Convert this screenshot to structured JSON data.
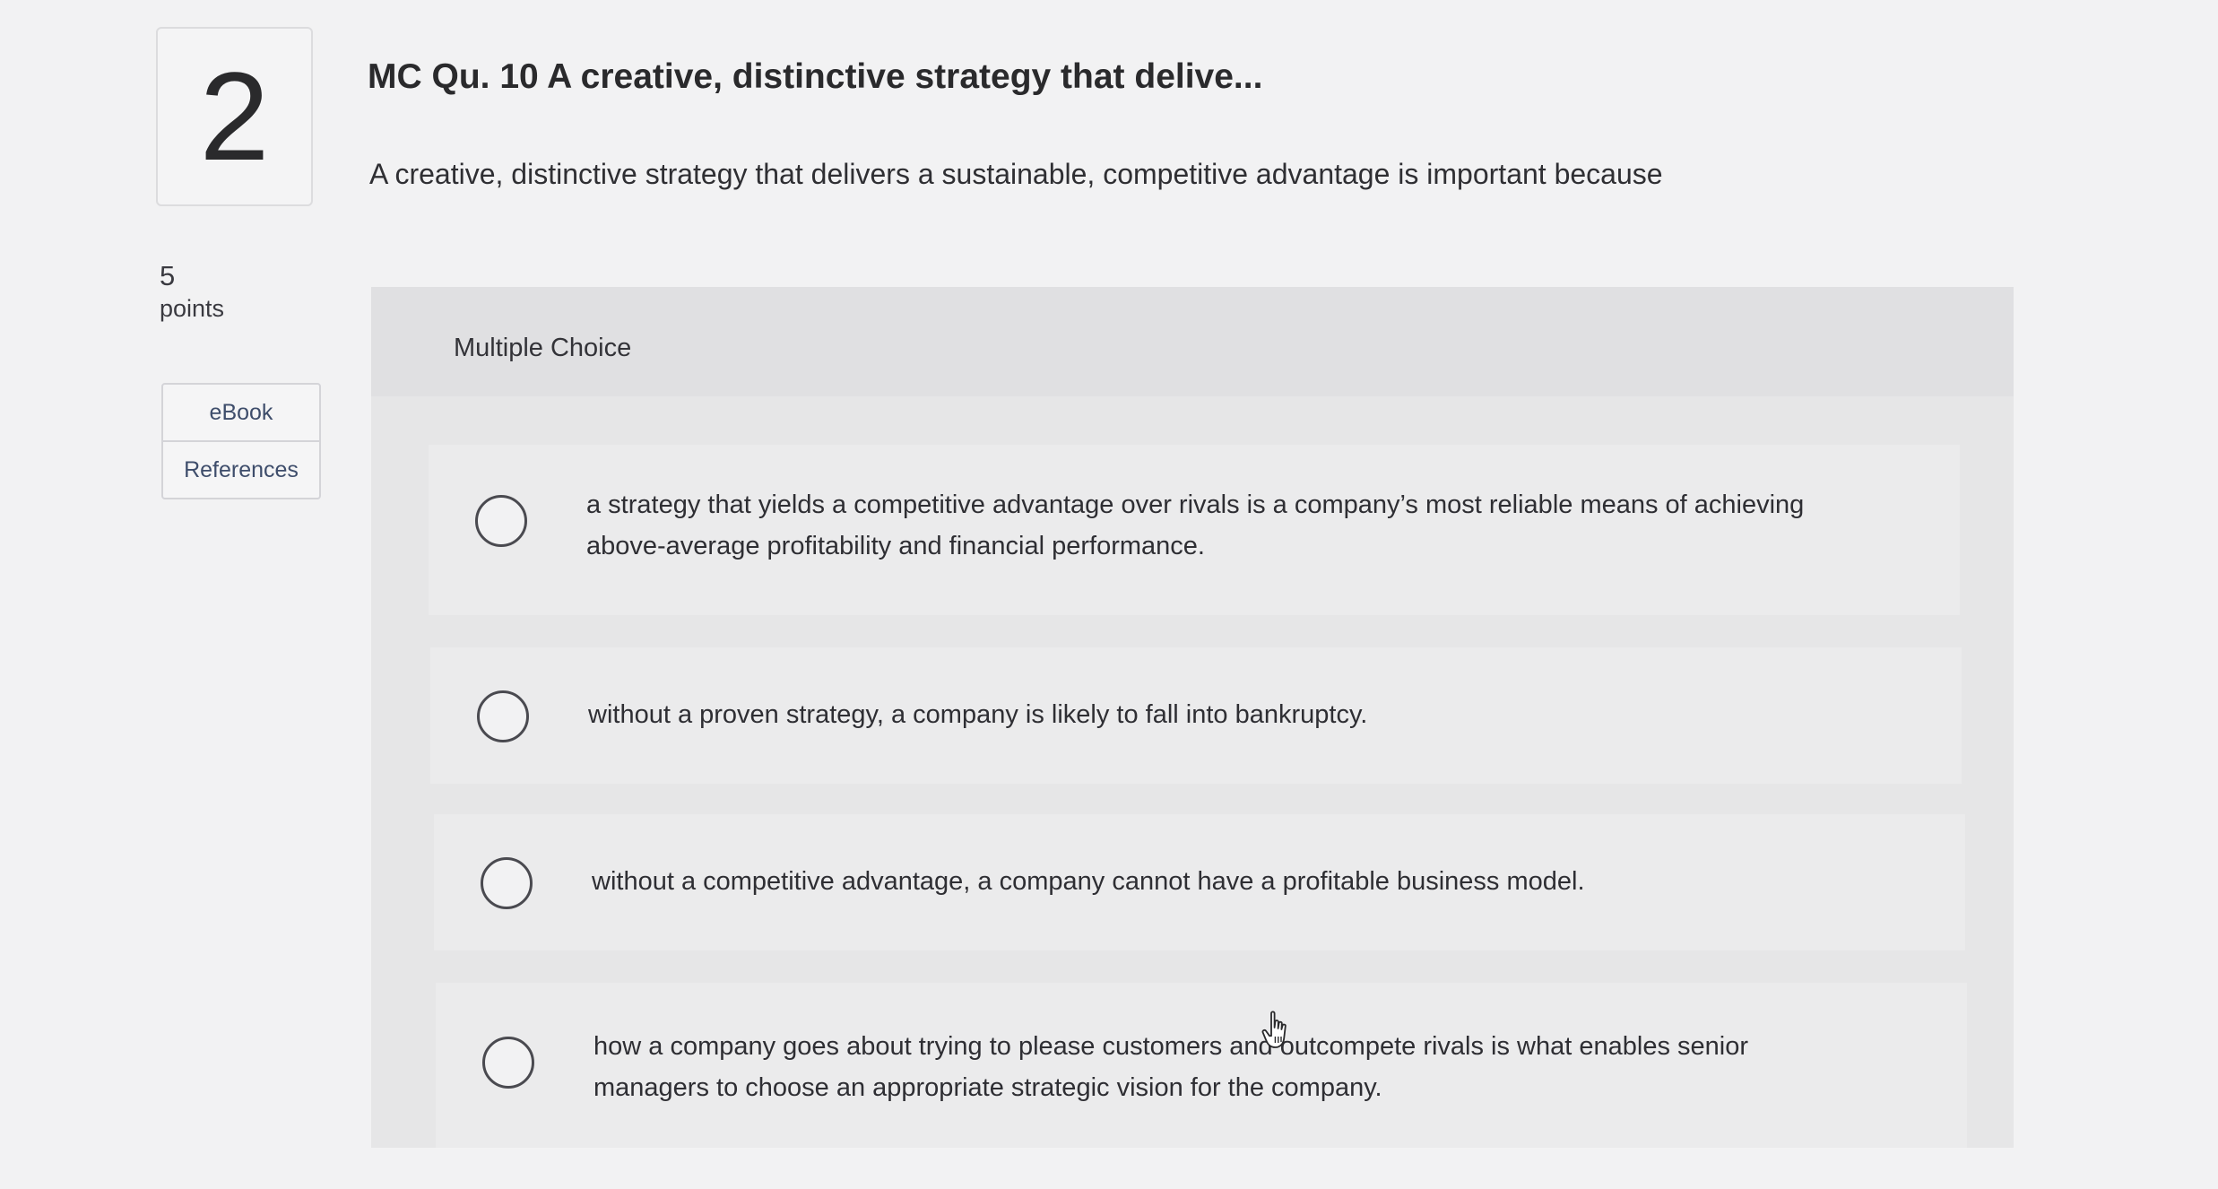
{
  "question": {
    "number": "2",
    "title": "MC Qu. 10 A creative, distinctive strategy that delive...",
    "prompt": "A creative, distinctive strategy that delivers a sustainable, competitive advantage is important because"
  },
  "points": {
    "value": "5",
    "label": "points"
  },
  "tools": {
    "ebook_label": "eBook",
    "references_label": "References"
  },
  "answer_panel": {
    "type_label": "Multiple Choice",
    "options": [
      {
        "text": "a strategy that yields a competitive advantage over rivals is a company’s most reliable means of achieving above-average profitability and financial performance.",
        "selected": false
      },
      {
        "text": "without a proven strategy, a company is likely to fall into bankruptcy.",
        "selected": false
      },
      {
        "text": "without a competitive advantage, a company cannot have a profitable business model.",
        "selected": false
      },
      {
        "text": "how a company goes about trying to please customers and outcompete rivals is what enables senior managers to choose an appropriate strategic vision for the company.",
        "selected": false
      }
    ]
  },
  "pointer": {
    "icon": "hand-pointer-icon"
  }
}
